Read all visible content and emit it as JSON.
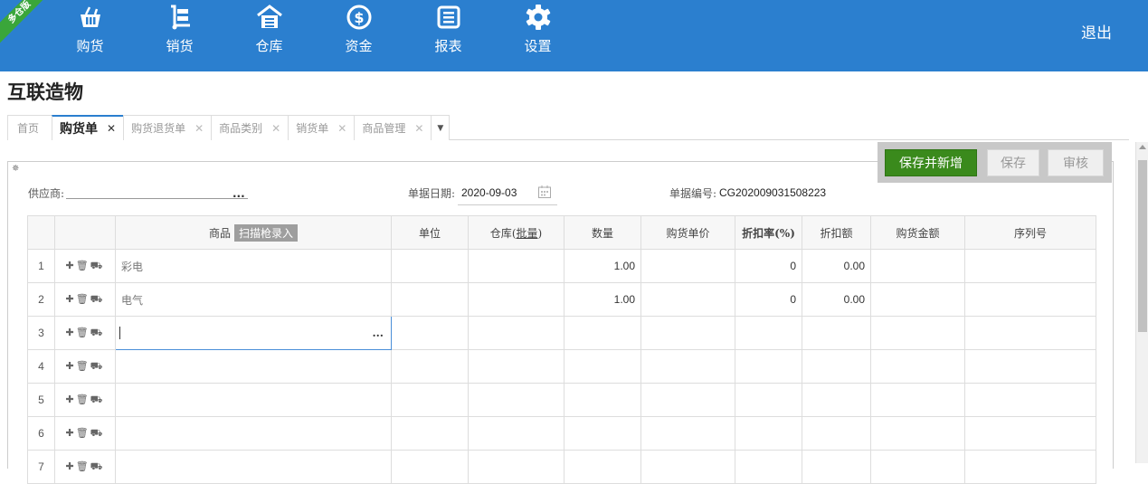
{
  "brand": {
    "ribbon_text": "多仓版"
  },
  "nav": [
    {
      "label": "购货",
      "icon": "basket-icon"
    },
    {
      "label": "销货",
      "icon": "hand-truck-icon"
    },
    {
      "label": "仓库",
      "icon": "warehouse-icon"
    },
    {
      "label": "资金",
      "icon": "dollar-icon"
    },
    {
      "label": "报表",
      "icon": "report-icon"
    },
    {
      "label": "设置",
      "icon": "gear-icon"
    }
  ],
  "header": {
    "logout": "退出",
    "company": "互联造物"
  },
  "tabs": [
    {
      "label": "首页"
    },
    {
      "label": "购货单",
      "active": true
    },
    {
      "label": "购货退货单"
    },
    {
      "label": "商品类别"
    },
    {
      "label": "销货单"
    },
    {
      "label": "商品管理"
    }
  ],
  "actions": {
    "save_new": "保存并新增",
    "save": "保存",
    "audit": "审核"
  },
  "form": {
    "supplier_label": "供应商:",
    "supplier_value": "",
    "more_dots": "...",
    "date_label": "单据日期:",
    "date_value": "2020-09-03",
    "code_label": "单据编号:",
    "code_value": "CG202009031508223"
  },
  "table": {
    "headers": {
      "product": "商品",
      "scan": "扫描枪录入",
      "unit": "单位",
      "warehouse": "仓库",
      "batch": "批量",
      "qty": "数量",
      "price": "购货单价",
      "discount_rate": "折扣率(%)",
      "discount_amount": "折扣额",
      "amount": "购货金额",
      "serial": "序列号"
    },
    "rows": [
      {
        "n": "1",
        "product": "彩电",
        "qty": "1.00",
        "rate": "0",
        "disc": "0.00"
      },
      {
        "n": "2",
        "product": "电气",
        "qty": "1.00",
        "rate": "0",
        "disc": "0.00"
      },
      {
        "n": "3",
        "product": "",
        "qty": "",
        "rate": "",
        "disc": ""
      },
      {
        "n": "4",
        "product": "",
        "qty": "",
        "rate": "",
        "disc": ""
      },
      {
        "n": "5",
        "product": "",
        "qty": "",
        "rate": "",
        "disc": ""
      },
      {
        "n": "6",
        "product": "",
        "qty": "",
        "rate": "",
        "disc": ""
      },
      {
        "n": "7",
        "product": "",
        "qty": "",
        "rate": "",
        "disc": ""
      }
    ],
    "edit_dots": "..."
  },
  "colors": {
    "topbar": "#2b7fcf",
    "primary_button": "#3a8a1c",
    "ribbon": "#3aa63a"
  }
}
